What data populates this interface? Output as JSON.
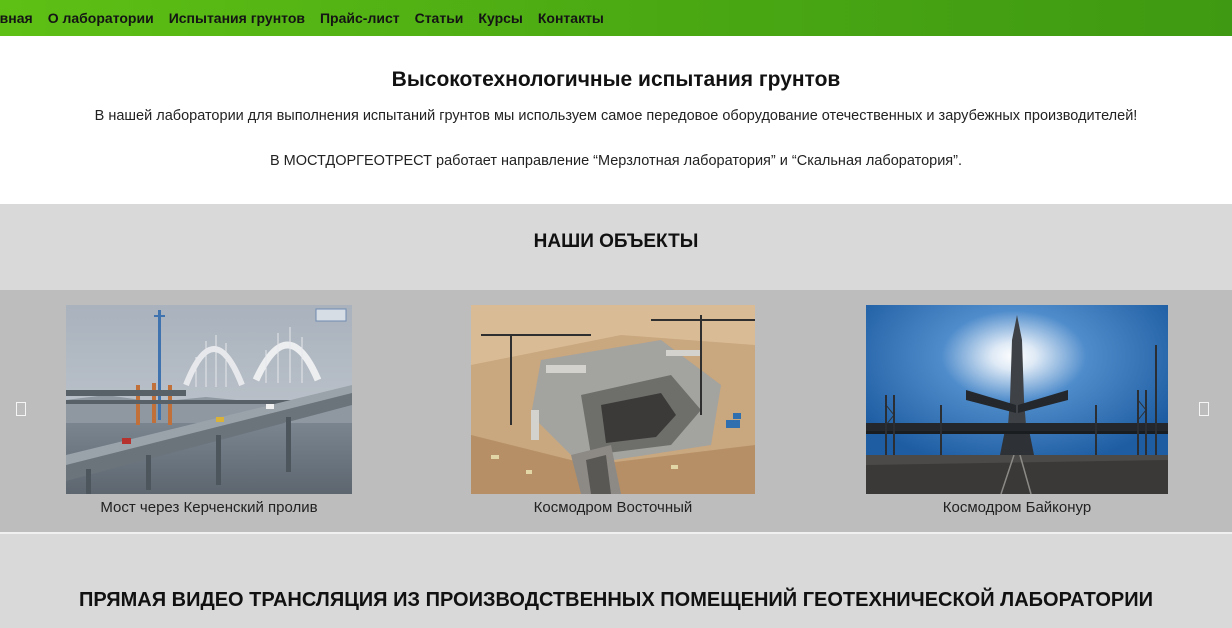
{
  "nav": {
    "items": [
      {
        "label": "лавная"
      },
      {
        "label": "О лаборатории"
      },
      {
        "label": "Испытания грунтов"
      },
      {
        "label": "Прайс-лист"
      },
      {
        "label": "Статьи"
      },
      {
        "label": "Курсы"
      },
      {
        "label": "Контакты"
      }
    ],
    "gradient_colors": [
      "#5ec014",
      "#3f9912"
    ]
  },
  "intro": {
    "title": "Высокотехнологичные испытания грунтов",
    "paragraph1": "В нашей лаборатории для выполнения испытаний грунтов мы используем самое передовое оборудование отечественных и зарубежных производителей!",
    "paragraph2": "В МОСТДОРГЕОТРЕСТ работает направление “Мерзлотная лаборатория” и “Скальная лаборатория”."
  },
  "objects": {
    "heading": "НАШИ ОБЪЕКТЫ",
    "prev_icon": "chevron-left-icon",
    "next_icon": "chevron-right-icon",
    "slides": [
      {
        "caption": "Мост через Керченский пролив",
        "image": "bridge-photo"
      },
      {
        "caption": "Космодром Восточный",
        "image": "construction-site-photo"
      },
      {
        "caption": "Космодром Байконур",
        "image": "rocket-launch-pad-photo"
      }
    ]
  },
  "live": {
    "heading": "ПРЯМАЯ ВИДЕО ТРАНСЛЯЦИЯ ИЗ ПРОИЗВОДСТВЕННЫХ ПОМЕЩЕНИЙ ГЕОТЕХНИЧЕСКОЙ ЛАБОРАТОРИИ"
  }
}
